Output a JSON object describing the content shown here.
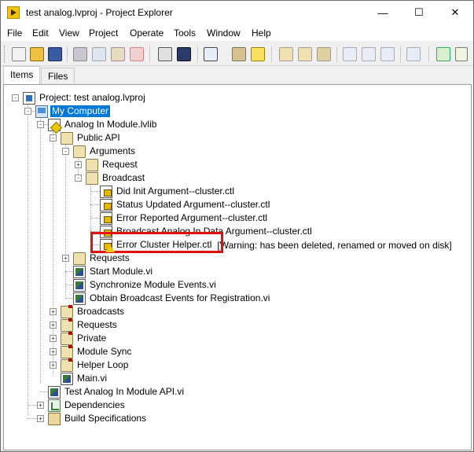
{
  "window": {
    "title": "test analog.lvproj - Project Explorer",
    "minimize_glyph": "—",
    "maximize_glyph": "☐",
    "close_glyph": "✕"
  },
  "menu": [
    "File",
    "Edit",
    "View",
    "Project",
    "Operate",
    "Tools",
    "Window",
    "Help"
  ],
  "tabs": [
    {
      "label": "Items",
      "active": true
    },
    {
      "label": "Files",
      "active": false
    }
  ],
  "toolbar_icons": [
    "new-icon",
    "open-icon",
    "save-all-icon",
    "cut-icon",
    "copy-icon",
    "paste-icon",
    "delete-icon",
    "build-icon",
    "deploy-icon",
    "view-icon",
    "dropdown-icon",
    "wrench-icon",
    "warning-icon",
    "collapse-icon",
    "expand-icon",
    "add-icon",
    "undo-icon",
    "redo-icon",
    "arrow-icon",
    "run-icon",
    "stop-icon"
  ],
  "tree": [
    {
      "label": "Project: test analog.lvproj",
      "icon": "project"
    },
    {
      "label": "My Computer",
      "icon": "computer",
      "selected": true
    },
    {
      "label": "Analog In Module.lvlib",
      "icon": "lib"
    },
    {
      "label": "Public API",
      "icon": "folder"
    },
    {
      "label": "Arguments",
      "icon": "folder"
    },
    {
      "label": "Request",
      "icon": "folder"
    },
    {
      "label": "Broadcast",
      "icon": "folder"
    },
    {
      "label": "Did Init Argument--cluster.ctl",
      "icon": "ctl"
    },
    {
      "label": "Status Updated Argument--cluster.ctl",
      "icon": "ctl"
    },
    {
      "label": "Error Reported Argument--cluster.ctl",
      "icon": "ctl"
    },
    {
      "label": "Broadcast Analog In Data Argument--cluster.ctl",
      "icon": "ctl"
    },
    {
      "label": "Error Cluster Helper.ctl",
      "icon": "ctl-warning",
      "warning": "[Warning:  has been deleted, renamed or moved on disk]"
    },
    {
      "label": "Requests",
      "icon": "folder"
    },
    {
      "label": "Start Module.vi",
      "icon": "vi"
    },
    {
      "label": "Synchronize Module Events.vi",
      "icon": "vi"
    },
    {
      "label": "Obtain Broadcast Events for Registration.vi",
      "icon": "vi"
    },
    {
      "label": "Broadcasts",
      "icon": "folder-flag"
    },
    {
      "label": "Requests",
      "icon": "folder-flag"
    },
    {
      "label": "Private",
      "icon": "folder-flag"
    },
    {
      "label": "Module Sync",
      "icon": "folder-flag"
    },
    {
      "label": "Helper Loop",
      "icon": "folder-flag"
    },
    {
      "label": "Main.vi",
      "icon": "vi"
    },
    {
      "label": "Test Analog In Module API.vi",
      "icon": "vi"
    },
    {
      "label": "Dependencies",
      "icon": "dep"
    },
    {
      "label": "Build Specifications",
      "icon": "build"
    }
  ]
}
